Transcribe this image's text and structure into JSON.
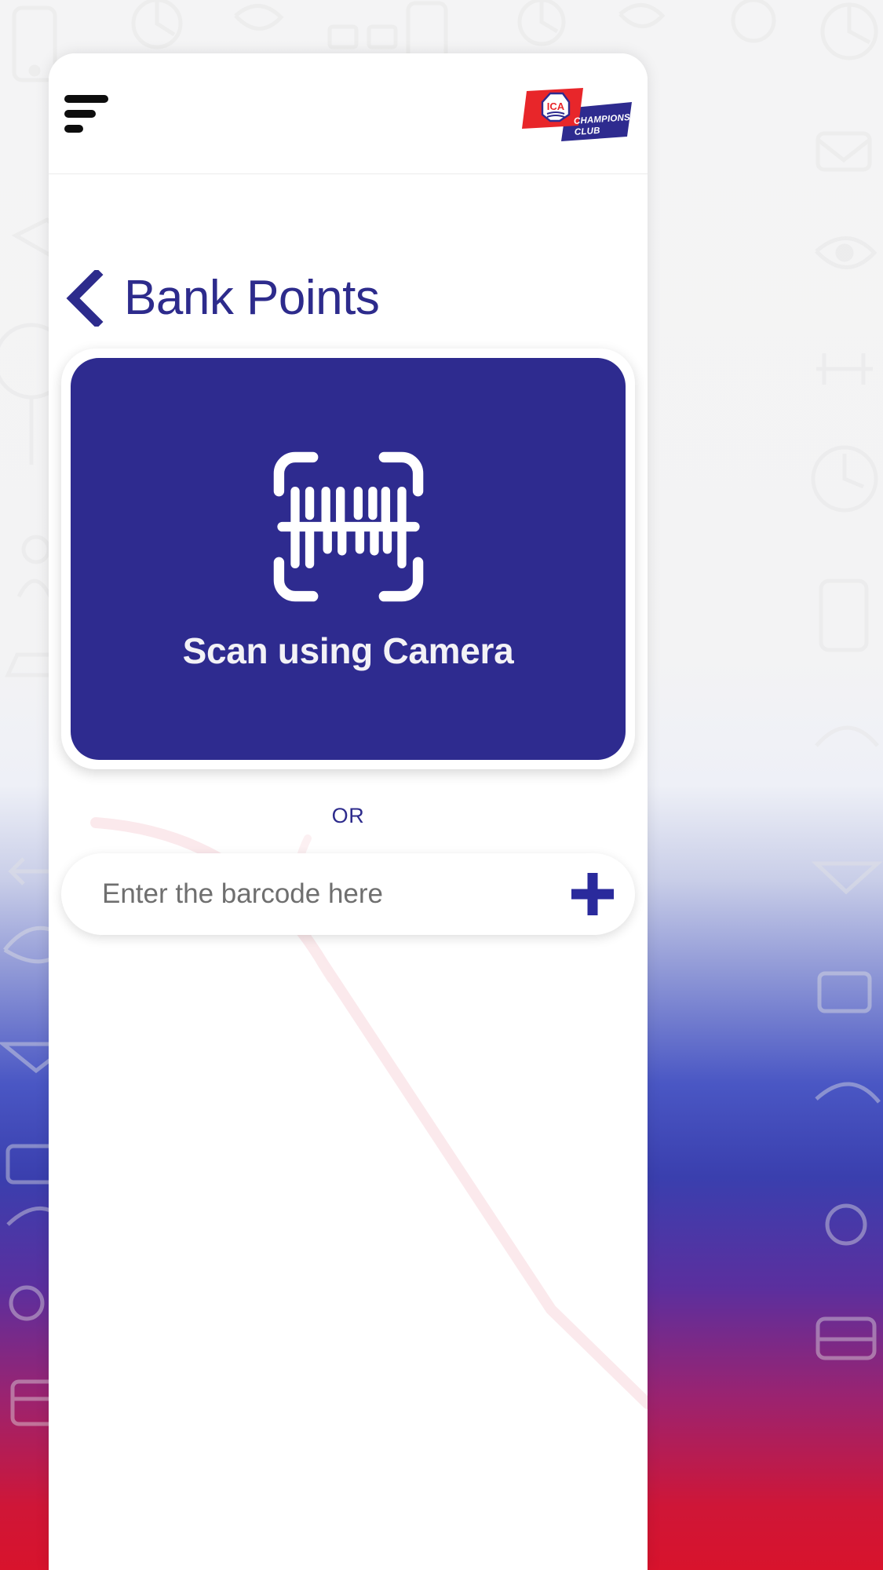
{
  "app": {
    "card_background": "#ffffff",
    "accent_navy": "#2e2b8f",
    "accent_red": "#e2231a"
  },
  "header": {
    "menu_icon": "hamburger-menu-icon",
    "logo": {
      "name": "ica-champions-club-logo",
      "primary_text": "ICA",
      "secondary_line1": "CHAMPIONS",
      "secondary_line2": "CLUB",
      "red": "#e8262a",
      "blue": "#2e2b8f"
    }
  },
  "page": {
    "back_icon": "back-chevron-icon",
    "title": "Bank Points"
  },
  "scan": {
    "icon": "barcode-scan-icon",
    "label": "Scan using Camera",
    "card_color": "#2e2b8f",
    "label_color": "#f3f2f6"
  },
  "divider": {
    "label": "OR"
  },
  "barcode_entry": {
    "placeholder": "Enter the barcode here",
    "value": "",
    "add_icon": "plus-icon",
    "add_icon_color": "#2a2a9c"
  }
}
